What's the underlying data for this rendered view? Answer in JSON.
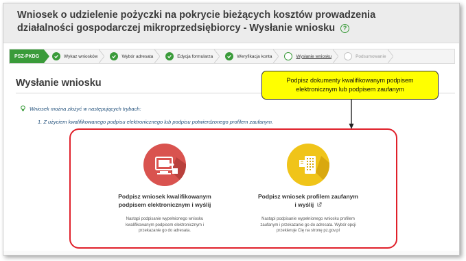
{
  "header": {
    "title": "Wniosek o udzielenie pożyczki na pokrycie bieżących kosztów prowadzenia działalności gospodarczej mikroprzedsiębiorcy - Wysłanie wniosku",
    "help_icon_glyph": "?"
  },
  "steps": {
    "code": "PSZ-PKDG",
    "items": [
      {
        "label": "Wykaz wniosków",
        "state": "done"
      },
      {
        "label": "Wybór adresata",
        "state": "done"
      },
      {
        "label": "Edycja formularza",
        "state": "done"
      },
      {
        "label": "Weryfikacja konta",
        "state": "done"
      },
      {
        "label": "Wysłanie wniosku",
        "state": "current"
      },
      {
        "label": "Podsumowanie",
        "state": "inactive"
      }
    ]
  },
  "main": {
    "section_title": "Wysłanie wniosku",
    "info_text": "Wniosek można złożyć w następujących trybach:",
    "mode_text": "1. Z użyciem kwalifikowanego podpisu elektronicznego lub podpisu potwierdzonego profilem zaufanym."
  },
  "callout": {
    "text": "Podpisz dokumenty kwalifikowanym podpisem elektronicznym lub podpisem zaufanym"
  },
  "options": [
    {
      "title_line1": "Podpisz wniosek kwalifikowanym",
      "title_line2": "podpisem elektronicznym i wyślij",
      "description": "Nastąpi podpisanie wypełnionego wniosku kwalifikowanym podpisem elektronicznym i przekazanie go do adresata.",
      "icon": "computer-signature-icon",
      "icon_color": "#d9534f"
    },
    {
      "title_line1": "Podpisz wniosek profilem zaufanym",
      "title_line2": "i wyślij",
      "description": "Nastąpi podpisanie wypełnionego wniosku profilem zaufanym i przekazanie go do adresata. Wybór opcji przekieruje Cię na stronę pz.gov.pl",
      "icon": "trusted-profile-icon",
      "icon_color": "#f0c419"
    }
  ],
  "colors": {
    "accent_green": "#3a9b3a",
    "highlight_red": "#e0202a",
    "callout_yellow": "#ffff00",
    "text_blue": "#1f4e79"
  }
}
